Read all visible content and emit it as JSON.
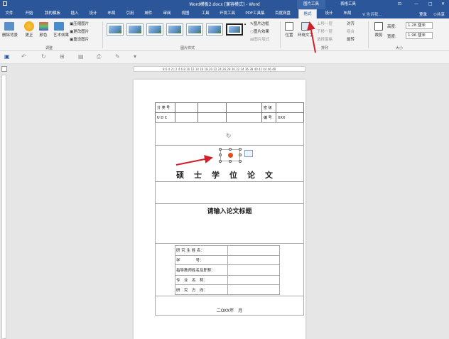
{
  "window": {
    "title": "Word模板2.docx [兼容模式] - Word",
    "context_picture": "图片工具",
    "context_table": "表格工具"
  },
  "tabs": [
    "文件",
    "开始",
    "我的模板",
    "插入",
    "设计",
    "布局",
    "引用",
    "邮件",
    "审阅",
    "视图",
    "工具",
    "开发工具",
    "PDF工具集",
    "百度网盘",
    "格式",
    "设计",
    "布局"
  ],
  "active_tab": "格式",
  "search_placeholder": "♀ 告诉我...",
  "login": "登录",
  "share": "共享",
  "ribbon": {
    "adjust": {
      "remove_bg": "删除背景",
      "correct": "更正",
      "color": "颜色",
      "art_effect": "艺术效果",
      "compress": "压缩图片",
      "change": "更改图片",
      "reset": "重设图片",
      "label": "调整"
    },
    "styles": {
      "label": "图片样式",
      "border": "图片边框",
      "effect": "图片效果",
      "layout": "图片版式"
    },
    "arrange": {
      "position": "位置",
      "wrap": "环绕文字",
      "forward": "上移一层",
      "backward": "下移一层",
      "pane": "选择窗格",
      "align": "对齐",
      "group": "组合",
      "rotate": "旋转",
      "label": "排列"
    },
    "size": {
      "crop": "裁剪",
      "height_label": "高度:",
      "height_val": "1.28 厘米",
      "width_label": "宽度:",
      "width_val": "1.96 厘米",
      "label": "大小"
    }
  },
  "ruler_text": "8 6 4 2 | 2 4 6 8 10 12 14 16 18 20 22 24 26 28 30 32 34 36 38 40 42 44 46 48",
  "doc": {
    "top_table": [
      [
        "分 类 号",
        "",
        "",
        "",
        "密 级",
        ""
      ],
      [
        "U D C",
        "",
        "",
        "",
        "编 号",
        "XXX"
      ]
    ],
    "thesis_title": "硕士学位论文",
    "prompt": "请输入论文标题",
    "info_rows": [
      "研 究 生 姓 名：",
      "学　　　　号：",
      "指导教师姓名及职称：",
      "专　业　名　称：",
      "研　究　方　向："
    ],
    "date": "二OXX年　月"
  },
  "colors": {
    "brand": "#2b579a",
    "arrow": "#d0202a"
  }
}
